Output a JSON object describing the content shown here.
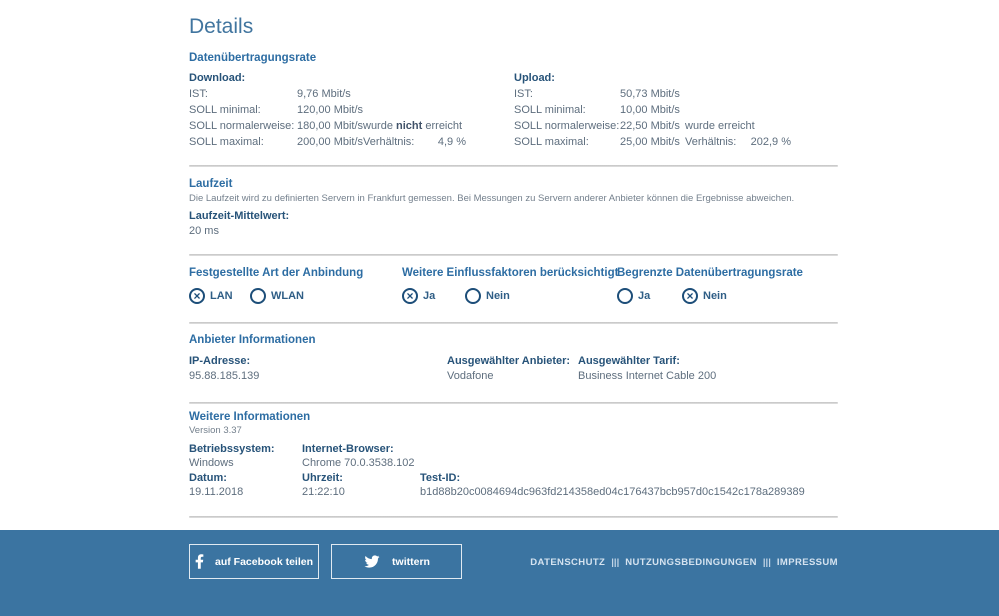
{
  "page": {
    "title": "Details"
  },
  "colors": {
    "accent_blue": "#2d6da3",
    "title_blue": "#41759f",
    "label_dark": "#275379",
    "body_text": "#5e6e7e",
    "radio_blue": "#1d4e79",
    "separator": "#cccccc",
    "footer_bg": "#3b74a1"
  },
  "transfer": {
    "header": "Datenübertragungsrate",
    "download": {
      "title": "Download:",
      "ist_label": "IST:",
      "ist_value": "9,76 Mbit/s",
      "min_label": "SOLL minimal:",
      "min_value": "120,00 Mbit/s",
      "norm_label": "SOLL normalerweise:",
      "norm_value": "180,00 Mbit/s",
      "norm_note_pre": "wurde ",
      "norm_note_bold": "nicht",
      "norm_note_post": " erreicht",
      "max_label": "SOLL maximal:",
      "max_value": "200,00 Mbit/s",
      "ratio_label": "Verhältnis:",
      "ratio_value": "4,9 %"
    },
    "upload": {
      "title": "Upload:",
      "ist_label": "IST:",
      "ist_value": "50,73 Mbit/s",
      "min_label": "SOLL minimal:",
      "min_value": "10,00 Mbit/s",
      "norm_label": "SOLL normalerweise:",
      "norm_value": "22,50 Mbit/s",
      "norm_note_pre": "wurde erreicht",
      "norm_note_bold": "",
      "norm_note_post": "",
      "max_label": "SOLL maximal:",
      "max_value": "25,00 Mbit/s",
      "ratio_label": "Verhältnis:",
      "ratio_value": "202,9 %"
    }
  },
  "latency": {
    "header": "Laufzeit",
    "description": "Die Laufzeit wird zu definierten Servern in Frankfurt gemessen. Bei Messungen zu Servern anderer Anbieter können die Ergebnisse abweichen.",
    "mean_label": "Laufzeit-Mittelwert:",
    "mean_value": "20 ms"
  },
  "connection": {
    "groups": [
      {
        "header": "Festgestellte Art der Anbindung",
        "options": [
          {
            "label": "LAN",
            "selected": true
          },
          {
            "label": "WLAN",
            "selected": false
          }
        ]
      },
      {
        "header": "Weitere Einflussfaktoren berücksichtigt",
        "options": [
          {
            "label": "Ja",
            "selected": true
          },
          {
            "label": "Nein",
            "selected": false
          }
        ]
      },
      {
        "header": "Begrenzte Datenübertragungsrate",
        "options": [
          {
            "label": "Ja",
            "selected": false
          },
          {
            "label": "Nein",
            "selected": true
          }
        ]
      }
    ]
  },
  "provider": {
    "header": "Anbieter Informationen",
    "ip_label": "IP-Adresse:",
    "ip_value": "95.88.185.139",
    "provider_label": "Ausgewählter Anbieter:",
    "provider_value": "Vodafone",
    "tariff_label": "Ausgewählter Tarif:",
    "tariff_value": "Business Internet Cable 200"
  },
  "more": {
    "header": "Weitere Informationen",
    "version": "Version 3.37",
    "os_label": "Betriebssystem:",
    "os_value": "Windows",
    "browser_label": "Internet-Browser:",
    "browser_value": "Chrome 70.0.3538.102",
    "date_label": "Datum:",
    "date_value": "19.11.2018",
    "time_label": "Uhrzeit:",
    "time_value": "21:22:10",
    "testid_label": "Test-ID:",
    "testid_value": "b1d88b20c0084694dc963fd214358ed04c176437bcb957d0c1542c178a289389"
  },
  "footer": {
    "facebook_label": "auf Facebook teilen",
    "twitter_label": "twittern",
    "links": [
      {
        "label": "DATENSCHUTZ"
      },
      {
        "label": "NUTZUNGSBEDINGUNGEN"
      },
      {
        "label": "IMPRESSUM"
      }
    ],
    "separator": "|||"
  }
}
